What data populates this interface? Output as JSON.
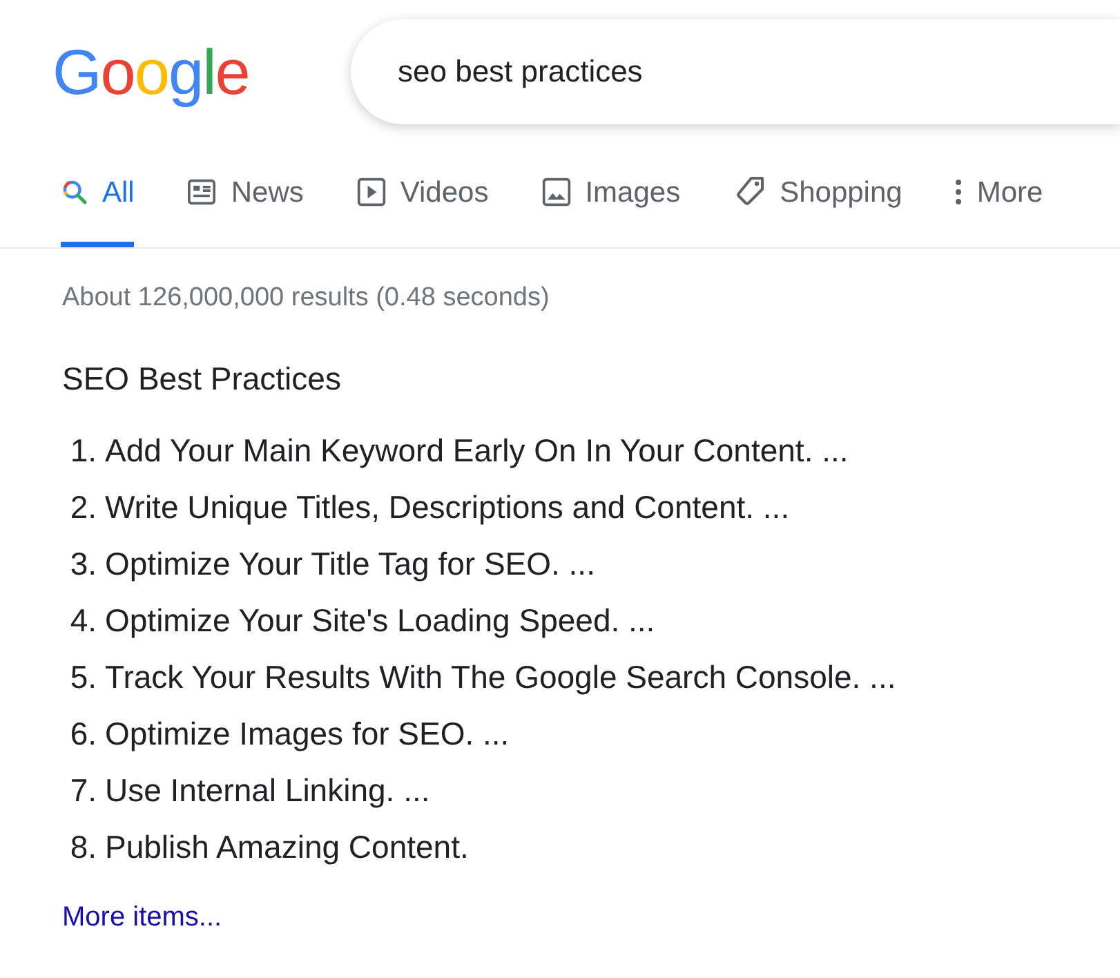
{
  "logo": "Google",
  "search": {
    "value": "seo best practices"
  },
  "tabs": [
    {
      "kind": "search",
      "label": "All",
      "selected": true
    },
    {
      "kind": "news",
      "label": "News",
      "selected": false
    },
    {
      "kind": "videos",
      "label": "Videos",
      "selected": false
    },
    {
      "kind": "images",
      "label": "Images",
      "selected": false
    },
    {
      "kind": "shopping",
      "label": "Shopping",
      "selected": false
    },
    {
      "kind": "more",
      "label": "More",
      "selected": false
    }
  ],
  "result_stats": "About 126,000,000 results (0.48 seconds)",
  "snippet": {
    "title": "SEO Best Practices",
    "items": [
      {
        "number": "1.",
        "text": "Add Your Main Keyword Early On In Your Content. ..."
      },
      {
        "number": "2.",
        "text": "Write Unique Titles, Descriptions and Content. ..."
      },
      {
        "number": "3.",
        "text": "Optimize Your Title Tag for SEO. ..."
      },
      {
        "number": "4.",
        "text": "Optimize Your Site's Loading Speed. ..."
      },
      {
        "number": "5.",
        "text": "Track Your Results With The Google Search Console. ..."
      },
      {
        "number": "6.",
        "text": "Optimize Images for SEO. ..."
      },
      {
        "number": "7.",
        "text": "Use Internal Linking. ..."
      },
      {
        "number": "8.",
        "text": "Publish Amazing Content."
      }
    ],
    "more_link": "More items..."
  }
}
